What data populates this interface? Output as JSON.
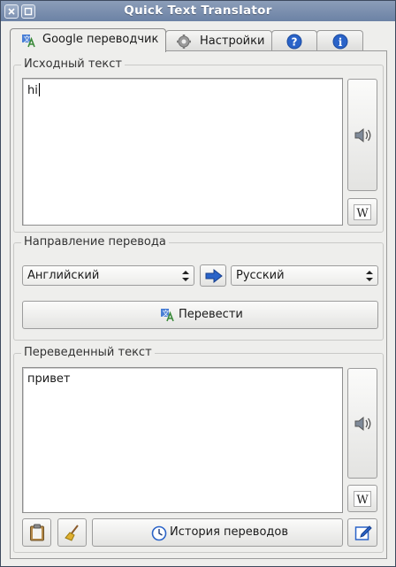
{
  "window": {
    "title": "Quick Text Translator"
  },
  "tabs": [
    {
      "label": "Google переводчик",
      "icon": "translate-icon"
    },
    {
      "label": "Настройки",
      "icon": "gear-icon"
    },
    {
      "label": "",
      "icon": "help-icon"
    },
    {
      "label": "",
      "icon": "info-icon"
    }
  ],
  "source": {
    "title": "Исходный текст",
    "text": "hi"
  },
  "direction": {
    "title": "Направление перевода",
    "from_language": "Английский",
    "to_language": "Русский",
    "translate_label": "Перевести"
  },
  "result": {
    "title": "Переведенный текст",
    "text": "привет"
  },
  "bottom": {
    "history_label": "История переводов"
  },
  "colors": {
    "titlebar": "#7b8fb0",
    "accent_blue": "#2a63c8"
  }
}
